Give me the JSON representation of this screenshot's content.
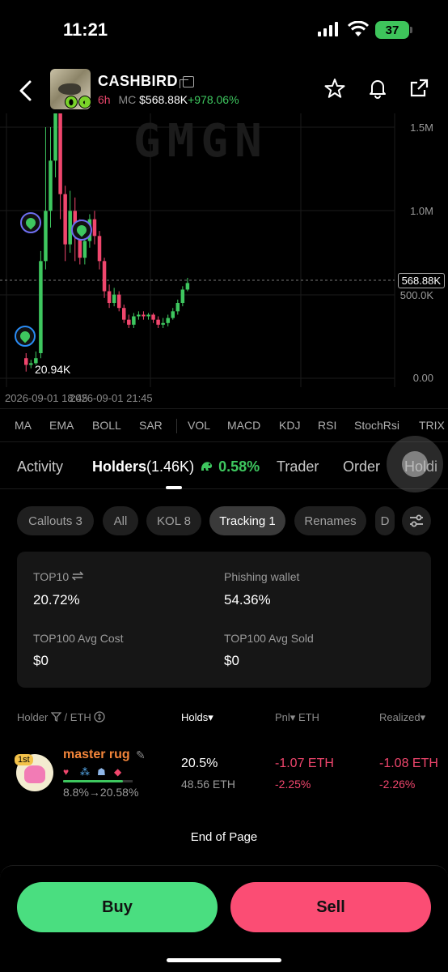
{
  "status_bar": {
    "time": "11:21",
    "battery": "37"
  },
  "header": {
    "token_name": "CASHBIRD",
    "age": "6h",
    "mc_label": "MC",
    "mc_value": "$568.88K",
    "mc_change": "+978.06%"
  },
  "chart": {
    "watermark": "GMGN",
    "y_labels": [
      "1.5M",
      "1.0M",
      "500.0K",
      "0.00"
    ],
    "current_price": "568.88K",
    "low_label": "20.94K",
    "x_labels": [
      "2026-09-01 18:45",
      "2026-09-01 21:45"
    ]
  },
  "chart_data": {
    "type": "candlestick",
    "ylim": [
      0,
      1500000
    ],
    "y_ticks": [
      "1.5M",
      "1.0M",
      "500.0K",
      "0.00"
    ],
    "x_ticks": [
      "2026-09-01 18:45",
      "2026-09-01 21:45"
    ],
    "current_price": "568.88K",
    "low_label": "20.94K",
    "candles": [
      {
        "o": 120000,
        "c": 80000,
        "h": 150000,
        "l": 40000
      },
      {
        "o": 80000,
        "c": 90000,
        "h": 110000,
        "l": 60000
      },
      {
        "o": 90000,
        "c": 120000,
        "h": 160000,
        "l": 80000
      },
      {
        "o": 150000,
        "c": 700000,
        "h": 760000,
        "l": 120000
      },
      {
        "o": 700000,
        "c": 1000000,
        "h": 1500000,
        "l": 650000
      },
      {
        "o": 1000000,
        "c": 1300000,
        "h": 1600000,
        "l": 900000
      },
      {
        "o": 1300000,
        "c": 1600000,
        "h": 1600000,
        "l": 1200000
      },
      {
        "o": 1600000,
        "c": 1100000,
        "h": 1600000,
        "l": 950000
      },
      {
        "o": 1100000,
        "c": 800000,
        "h": 1150000,
        "l": 700000
      },
      {
        "o": 800000,
        "c": 1000000,
        "h": 1120000,
        "l": 750000
      },
      {
        "o": 1000000,
        "c": 850000,
        "h": 1080000,
        "l": 700000
      },
      {
        "o": 850000,
        "c": 720000,
        "h": 950000,
        "l": 680000
      },
      {
        "o": 720000,
        "c": 820000,
        "h": 900000,
        "l": 680000
      },
      {
        "o": 820000,
        "c": 950000,
        "h": 980000,
        "l": 780000
      },
      {
        "o": 950000,
        "c": 850000,
        "h": 1000000,
        "l": 800000
      },
      {
        "o": 850000,
        "c": 700000,
        "h": 880000,
        "l": 650000
      },
      {
        "o": 700000,
        "c": 520000,
        "h": 720000,
        "l": 480000
      },
      {
        "o": 520000,
        "c": 450000,
        "h": 560000,
        "l": 420000
      },
      {
        "o": 450000,
        "c": 500000,
        "h": 540000,
        "l": 430000
      },
      {
        "o": 500000,
        "c": 420000,
        "h": 520000,
        "l": 400000
      },
      {
        "o": 420000,
        "c": 350000,
        "h": 440000,
        "l": 330000
      },
      {
        "o": 350000,
        "c": 320000,
        "h": 380000,
        "l": 300000
      },
      {
        "o": 320000,
        "c": 370000,
        "h": 390000,
        "l": 300000
      },
      {
        "o": 370000,
        "c": 380000,
        "h": 400000,
        "l": 350000
      },
      {
        "o": 380000,
        "c": 370000,
        "h": 400000,
        "l": 350000
      },
      {
        "o": 370000,
        "c": 380000,
        "h": 390000,
        "l": 350000
      },
      {
        "o": 380000,
        "c": 350000,
        "h": 390000,
        "l": 330000
      },
      {
        "o": 350000,
        "c": 320000,
        "h": 370000,
        "l": 300000
      },
      {
        "o": 320000,
        "c": 330000,
        "h": 360000,
        "l": 300000
      },
      {
        "o": 330000,
        "c": 360000,
        "h": 380000,
        "l": 310000
      },
      {
        "o": 360000,
        "c": 400000,
        "h": 420000,
        "l": 350000
      },
      {
        "o": 400000,
        "c": 450000,
        "h": 470000,
        "l": 380000
      },
      {
        "o": 450000,
        "c": 530000,
        "h": 550000,
        "l": 430000
      },
      {
        "o": 530000,
        "c": 569000,
        "h": 600000,
        "l": 520000
      }
    ]
  },
  "indicators": [
    "MA",
    "EMA",
    "BOLL",
    "SAR",
    "VOL",
    "MACD",
    "KDJ",
    "RSI",
    "StochRsi",
    "TRIX"
  ],
  "tabs": {
    "activity": "Activity",
    "holders": "Holders",
    "holders_count": "(1.46K)",
    "holders_pct": "0.58%",
    "trader": "Trader",
    "order": "Order",
    "holding": "Holdi"
  },
  "filters": [
    "Callouts 3",
    "All",
    "KOL 8",
    "Tracking 1",
    "Renames",
    "D"
  ],
  "stats": {
    "top10_label": "TOP10",
    "top10_value": "20.72%",
    "phishing_label": "Phishing wallet",
    "phishing_value": "54.36%",
    "avg_cost_label": "TOP100 Avg Cost",
    "avg_cost_value": "$0",
    "avg_sold_label": "TOP100 Avg Sold",
    "avg_sold_value": "$0"
  },
  "table": {
    "headers": {
      "holder": "Holder",
      "eth": "/ ETH",
      "holds": "Holds",
      "pnl": "Pnl",
      "pnl_eth": "ETH",
      "realized": "Realized"
    },
    "rows": [
      {
        "rank": "1st",
        "name": "master rug",
        "hold_change": "8.8%→20.58%",
        "hold_fraction": 0.206,
        "holds_pct": "20.5%",
        "holds_eth": "48.56 ETH",
        "pnl_eth": "-1.07 ETH",
        "pnl_pct": "-2.25%",
        "realized_eth": "-1.08 ETH",
        "realized_pct": "-2.26%"
      }
    ],
    "end_text": "End of Page"
  },
  "actions": {
    "buy": "Buy",
    "sell": "Sell"
  },
  "colors": {
    "buy": "#4ade80",
    "sell": "#fb4d74",
    "up": "#3ec75f",
    "down": "#f0466d",
    "accent_orange": "#f2853a"
  }
}
